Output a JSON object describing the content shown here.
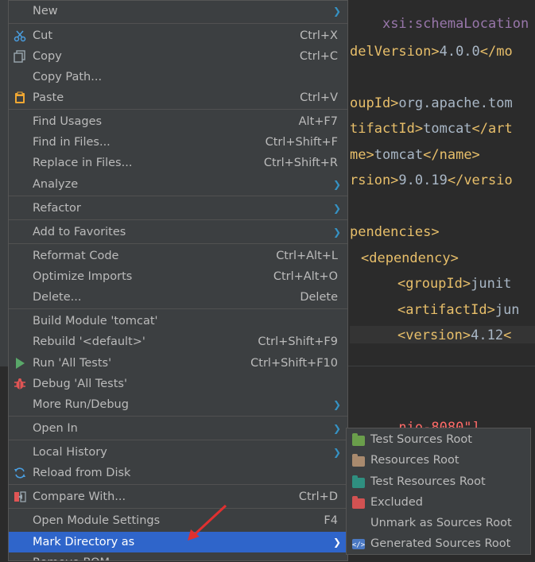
{
  "editor": {
    "lines": [
      {
        "tag": "xsi:schemaLocation",
        "text": "",
        "close": ""
      },
      {
        "tag": "delVersion>",
        "text": "4.0.0",
        "close": "</mo"
      },
      {
        "tag": "oupId>",
        "text": "org.apache.tom",
        "close": ""
      },
      {
        "tag": "tifactId>",
        "text": "tomcat",
        "close": "</art"
      },
      {
        "tag": "me>",
        "text": "tomcat",
        "close": "</name>"
      },
      {
        "tag": "rsion>",
        "text": "9.0.19",
        "close": "</versio"
      },
      {
        "tag": "pendencies>",
        "text": "",
        "close": ""
      },
      {
        "tag": "<dependency>",
        "text": "",
        "close": ""
      },
      {
        "tag": "<groupId>",
        "text": "junit",
        "close": ""
      },
      {
        "tag": "<artifactId>",
        "text": "jun",
        "close": ""
      },
      {
        "tag": "<version>",
        "text": "4.12",
        "close": "<"
      }
    ],
    "log_text": "nio-8080\"]"
  },
  "menu": {
    "items": [
      {
        "label": "New",
        "shortcut": "",
        "submenu": true,
        "icon": ""
      },
      {
        "label": "Cut",
        "shortcut": "Ctrl+X",
        "submenu": false,
        "icon": "scissors-icon"
      },
      {
        "label": "Copy",
        "shortcut": "Ctrl+C",
        "submenu": false,
        "icon": "copy-icon"
      },
      {
        "label": "Copy Path...",
        "shortcut": "",
        "submenu": false,
        "icon": ""
      },
      {
        "label": "Paste",
        "shortcut": "Ctrl+V",
        "submenu": false,
        "icon": "clipboard-icon"
      },
      {
        "label": "Find Usages",
        "shortcut": "Alt+F7",
        "submenu": false,
        "icon": ""
      },
      {
        "label": "Find in Files...",
        "shortcut": "Ctrl+Shift+F",
        "submenu": false,
        "icon": ""
      },
      {
        "label": "Replace in Files...",
        "shortcut": "Ctrl+Shift+R",
        "submenu": false,
        "icon": ""
      },
      {
        "label": "Analyze",
        "shortcut": "",
        "submenu": true,
        "icon": ""
      },
      {
        "label": "Refactor",
        "shortcut": "",
        "submenu": true,
        "icon": ""
      },
      {
        "label": "Add to Favorites",
        "shortcut": "",
        "submenu": true,
        "icon": ""
      },
      {
        "label": "Reformat Code",
        "shortcut": "Ctrl+Alt+L",
        "submenu": false,
        "icon": ""
      },
      {
        "label": "Optimize Imports",
        "shortcut": "Ctrl+Alt+O",
        "submenu": false,
        "icon": ""
      },
      {
        "label": "Delete...",
        "shortcut": "Delete",
        "submenu": false,
        "icon": ""
      },
      {
        "label": "Build Module 'tomcat'",
        "shortcut": "",
        "submenu": false,
        "icon": ""
      },
      {
        "label": "Rebuild '<default>'",
        "shortcut": "Ctrl+Shift+F9",
        "submenu": false,
        "icon": ""
      },
      {
        "label": "Run 'All Tests'",
        "shortcut": "Ctrl+Shift+F10",
        "submenu": false,
        "icon": "run-icon"
      },
      {
        "label": "Debug 'All Tests'",
        "shortcut": "",
        "submenu": false,
        "icon": "debug-icon"
      },
      {
        "label": "More Run/Debug",
        "shortcut": "",
        "submenu": true,
        "icon": ""
      },
      {
        "label": "Open In",
        "shortcut": "",
        "submenu": true,
        "icon": ""
      },
      {
        "label": "Local History",
        "shortcut": "",
        "submenu": true,
        "icon": ""
      },
      {
        "label": "Reload from Disk",
        "shortcut": "",
        "submenu": false,
        "icon": "reload-icon"
      },
      {
        "label": "Compare With...",
        "shortcut": "Ctrl+D",
        "submenu": false,
        "icon": "compare-icon"
      },
      {
        "label": "Open Module Settings",
        "shortcut": "F4",
        "submenu": false,
        "icon": ""
      },
      {
        "label": "Mark Directory as",
        "shortcut": "",
        "submenu": true,
        "icon": "",
        "selected": true
      },
      {
        "label": "Remove BOM",
        "shortcut": "",
        "submenu": false,
        "icon": ""
      }
    ]
  },
  "submenu": {
    "items": [
      {
        "label": "Test Sources Root",
        "icon": "test-sources-folder-icon",
        "color": "#6a9e4b"
      },
      {
        "label": "Resources Root",
        "icon": "resources-folder-icon",
        "color": "#a98a6e"
      },
      {
        "label": "Test Resources Root",
        "icon": "test-resources-folder-icon",
        "color": "#2f8f80"
      },
      {
        "label": "Excluded",
        "icon": "excluded-folder-icon",
        "color": "#d25252"
      },
      {
        "label": "Unmark as Sources Root",
        "icon": "",
        "color": ""
      },
      {
        "label": "Generated Sources Root",
        "icon": "generated-sources-folder-icon",
        "color": "#4a78c2"
      }
    ]
  },
  "colors": {
    "menu_bg": "#3c3f41",
    "selection": "#2f65ca",
    "arrow": "#3592c4",
    "annotation": "#e03030"
  }
}
